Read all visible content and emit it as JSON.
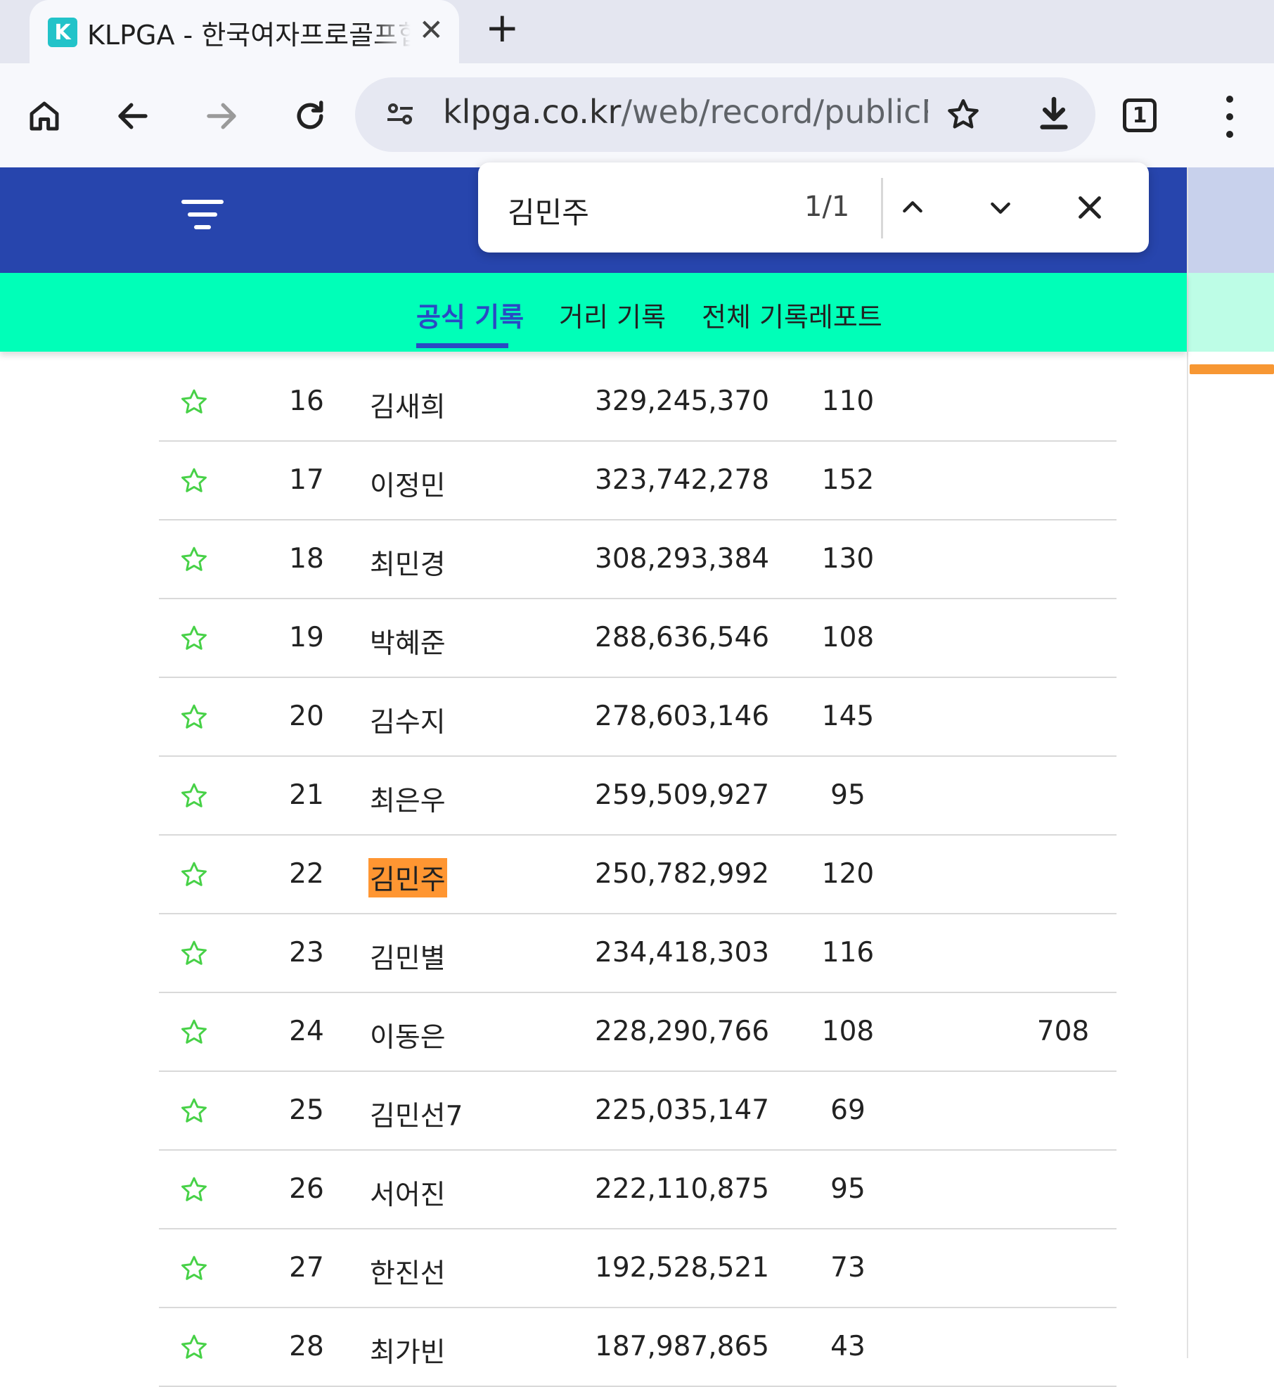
{
  "browser": {
    "tab_title": "KLPGA - 한국여자프로골프협회",
    "favicon_letter": "K",
    "url_host": "klpga.co.kr",
    "url_path": "/web/record/publicRec",
    "tab_count": "1",
    "colors": {
      "tabstrip_bg": "#e4e6f0",
      "toolbar_bg": "#f7f8fc",
      "omnibox_bg": "#e6e8f2"
    }
  },
  "find_bar": {
    "query": "김민주",
    "count": "1/1"
  },
  "site": {
    "colors": {
      "header": "#2745ad",
      "subnav": "#00ffb8",
      "active": "#2a49c4",
      "highlight": "#ff9632",
      "star": "#47d147"
    },
    "subnav": [
      {
        "label": "공식 기록",
        "active": true
      },
      {
        "label": "거리 기록",
        "active": false
      },
      {
        "label": "전체 기록레포트",
        "active": false
      }
    ]
  },
  "table": {
    "rows": [
      {
        "rank": "16",
        "name": "김새희",
        "money": "329,245,370",
        "count": "110",
        "extra": ""
      },
      {
        "rank": "17",
        "name": "이정민",
        "money": "323,742,278",
        "count": "152",
        "extra": ""
      },
      {
        "rank": "18",
        "name": "최민경",
        "money": "308,293,384",
        "count": "130",
        "extra": ""
      },
      {
        "rank": "19",
        "name": "박혜준",
        "money": "288,636,546",
        "count": "108",
        "extra": ""
      },
      {
        "rank": "20",
        "name": "김수지",
        "money": "278,603,146",
        "count": "145",
        "extra": ""
      },
      {
        "rank": "21",
        "name": "최은우",
        "money": "259,509,927",
        "count": "95",
        "extra": ""
      },
      {
        "rank": "22",
        "name": "김민주",
        "money": "250,782,992",
        "count": "120",
        "extra": "",
        "highlight": true
      },
      {
        "rank": "23",
        "name": "김민별",
        "money": "234,418,303",
        "count": "116",
        "extra": ""
      },
      {
        "rank": "24",
        "name": "이동은",
        "money": "228,290,766",
        "count": "108",
        "extra": "708"
      },
      {
        "rank": "25",
        "name": "김민선7",
        "money": "225,035,147",
        "count": "69",
        "extra": ""
      },
      {
        "rank": "26",
        "name": "서어진",
        "money": "222,110,875",
        "count": "95",
        "extra": ""
      },
      {
        "rank": "27",
        "name": "한진선",
        "money": "192,528,521",
        "count": "73",
        "extra": ""
      },
      {
        "rank": "28",
        "name": "최가빈",
        "money": "187,987,865",
        "count": "43",
        "extra": ""
      }
    ]
  }
}
